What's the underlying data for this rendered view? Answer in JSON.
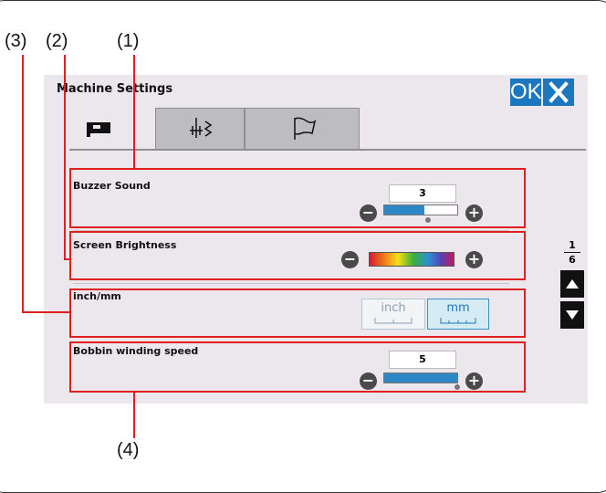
{
  "callouts": [
    "(3)",
    "(2)",
    "(1)",
    "(4)"
  ],
  "window": {
    "title": "Machine Settings",
    "ok_label": "OK"
  },
  "tabs": [
    {
      "name": "machine-tab",
      "icon": "sewing-machine-icon",
      "active": true
    },
    {
      "name": "sewing-tab",
      "icon": "presser-foot-icon",
      "active": false
    },
    {
      "name": "flag-tab",
      "icon": "flag-icon",
      "active": false
    }
  ],
  "settings": {
    "buzzer": {
      "label": "Buzzer Sound",
      "value": "3",
      "level": 0.55
    },
    "brightness": {
      "label": "Screen Brightness"
    },
    "units": {
      "label": "inch/mm",
      "options": [
        "inch",
        "mm"
      ],
      "selected": "mm"
    },
    "bobbin": {
      "label": "Bobbin winding speed",
      "value": "5",
      "level": 1.0
    }
  },
  "pager": {
    "current": "1",
    "total": "6"
  },
  "colors": {
    "accent": "#1b77bf",
    "highlight": "#e0201e",
    "panel": "#ece7ec"
  }
}
